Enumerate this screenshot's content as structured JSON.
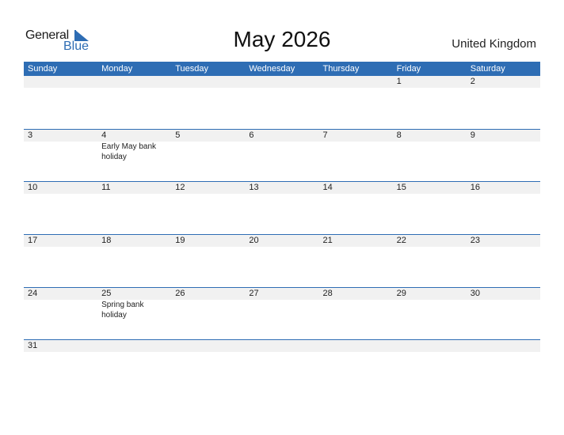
{
  "logo": {
    "word1": "General",
    "word2": "Blue",
    "brand_color": "#2e6db4"
  },
  "title": "May 2026",
  "country": "United Kingdom",
  "colors": {
    "header_bg": "#2e6db4",
    "strip_bg": "#f1f1f1",
    "separator": "#2e6db4"
  },
  "weekdays": [
    "Sunday",
    "Monday",
    "Tuesday",
    "Wednesday",
    "Thursday",
    "Friday",
    "Saturday"
  ],
  "weeks": [
    [
      {
        "day": "",
        "event": ""
      },
      {
        "day": "",
        "event": ""
      },
      {
        "day": "",
        "event": ""
      },
      {
        "day": "",
        "event": ""
      },
      {
        "day": "",
        "event": ""
      },
      {
        "day": "1",
        "event": ""
      },
      {
        "day": "2",
        "event": ""
      }
    ],
    [
      {
        "day": "3",
        "event": ""
      },
      {
        "day": "4",
        "event": "Early May bank holiday"
      },
      {
        "day": "5",
        "event": ""
      },
      {
        "day": "6",
        "event": ""
      },
      {
        "day": "7",
        "event": ""
      },
      {
        "day": "8",
        "event": ""
      },
      {
        "day": "9",
        "event": ""
      }
    ],
    [
      {
        "day": "10",
        "event": ""
      },
      {
        "day": "11",
        "event": ""
      },
      {
        "day": "12",
        "event": ""
      },
      {
        "day": "13",
        "event": ""
      },
      {
        "day": "14",
        "event": ""
      },
      {
        "day": "15",
        "event": ""
      },
      {
        "day": "16",
        "event": ""
      }
    ],
    [
      {
        "day": "17",
        "event": ""
      },
      {
        "day": "18",
        "event": ""
      },
      {
        "day": "19",
        "event": ""
      },
      {
        "day": "20",
        "event": ""
      },
      {
        "day": "21",
        "event": ""
      },
      {
        "day": "22",
        "event": ""
      },
      {
        "day": "23",
        "event": ""
      }
    ],
    [
      {
        "day": "24",
        "event": ""
      },
      {
        "day": "25",
        "event": "Spring bank holiday"
      },
      {
        "day": "26",
        "event": ""
      },
      {
        "day": "27",
        "event": ""
      },
      {
        "day": "28",
        "event": ""
      },
      {
        "day": "29",
        "event": ""
      },
      {
        "day": "30",
        "event": ""
      }
    ],
    [
      {
        "day": "31",
        "event": ""
      },
      {
        "day": "",
        "event": ""
      },
      {
        "day": "",
        "event": ""
      },
      {
        "day": "",
        "event": ""
      },
      {
        "day": "",
        "event": ""
      },
      {
        "day": "",
        "event": ""
      },
      {
        "day": "",
        "event": ""
      }
    ]
  ]
}
